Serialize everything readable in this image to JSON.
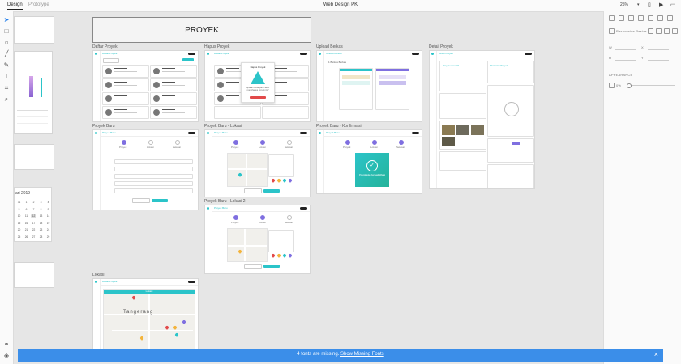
{
  "topbar": {
    "tabs": [
      "Design",
      "Prototype"
    ],
    "document_title": "Web Design PK",
    "zoom": "25%",
    "icons": [
      "chevron-down-icon",
      "mobile-preview-icon",
      "play-icon",
      "share-icon"
    ]
  },
  "tools": [
    "select-icon",
    "rectangle-icon",
    "ellipse-icon",
    "line-icon",
    "pen-icon",
    "text-icon",
    "artboard-icon",
    "zoom-icon",
    "assets-icon",
    "layers-icon"
  ],
  "right_panel": {
    "fields": {
      "w": "W",
      "h": "H",
      "x": "X",
      "y": "Y"
    },
    "responsive_label": "Responsive Resize",
    "appearance_label": "APPEARANCE",
    "opacity": "0%"
  },
  "board_title": "PROYEK",
  "artboards": {
    "daftar": {
      "label": "Daftar Proyek",
      "title": "Daftar Proyek"
    },
    "hapus": {
      "label": "Hapus Proyek",
      "title": "Daftar Proyek",
      "dialog_title": "Hapus Proyek",
      "dialog_text": "Apakah anda yakin akan menghapus proyek ini?"
    },
    "upload": {
      "label": "Upload Berkas",
      "title": "Upload Berkas",
      "subtitle": "1 Berkas Berkas"
    },
    "detail": {
      "label": "Detail Proyek",
      "title": "Detail Proyek",
      "section_a": "Proyek name #1",
      "section_b": "Perincian Proyek"
    },
    "baru": {
      "label": "Proyek Baru",
      "title": "Proyek Baru",
      "steps": [
        "Proyek",
        "Lokasi",
        "Selesai"
      ]
    },
    "baru_lokasi": {
      "label": "Proyek Baru - Lokasi",
      "title": "Proyek Baru",
      "steps": [
        "Proyek",
        "Lokasi",
        "Selesai"
      ]
    },
    "baru_lokasi2": {
      "label": "Proyek Baru - Lokasi 2",
      "title": "Proyek Baru",
      "steps": [
        "Proyek",
        "Lokasi",
        "Selesai"
      ]
    },
    "konfirmasi": {
      "label": "Proyek Baru - Konfirmasi",
      "title": "Proyek Baru",
      "steps": [
        "Proyek",
        "Lokasi",
        "Selesai"
      ],
      "success_text": "Proyek telah berhasil dibuat"
    },
    "lokasi": {
      "label": "Lokasi",
      "title": "Daftar Proyek",
      "map_tab": "Lokasi",
      "map_city": "Tangerang"
    }
  },
  "calendar": {
    "title": "ari 2019",
    "days": [
      "31",
      "1",
      "2",
      "3",
      "4",
      "5",
      "6",
      "7",
      "8",
      "9",
      "10",
      "11",
      "12",
      "13",
      "14",
      "15",
      "16",
      "17",
      "18",
      "19",
      "20",
      "21",
      "22",
      "23",
      "24",
      "25",
      "26",
      "27",
      "28",
      "29"
    ]
  },
  "notification": {
    "text": "4 fonts are missing.",
    "link": "Show Missing Fonts",
    "close_icon": "close-icon"
  },
  "colors": {
    "accent": "#2bc4c9",
    "notify": "#3b8ee9",
    "step_active": "#7f6fe0"
  }
}
